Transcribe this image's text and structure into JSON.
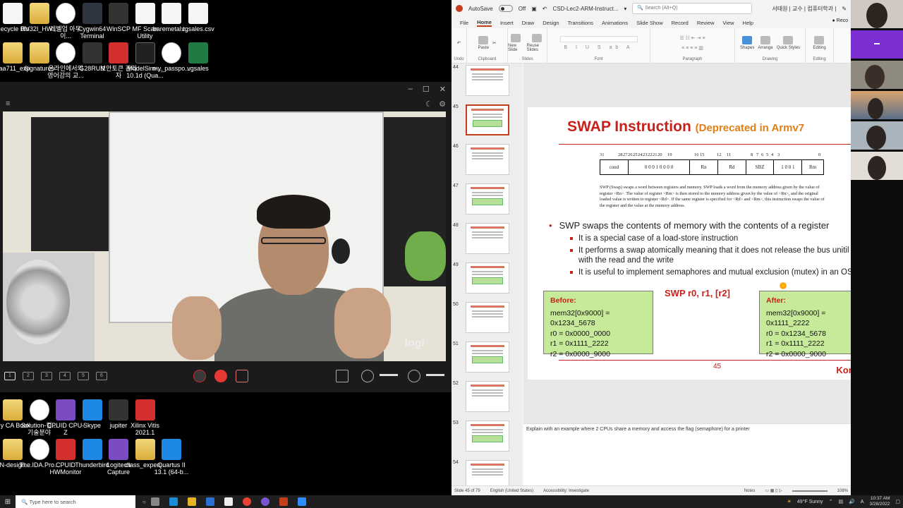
{
  "desktop": {
    "icons_top": [
      {
        "label": "Recycle Bin",
        "icon": "recycle-bin-icon"
      },
      {
        "label": "RV32I_HW...",
        "icon": "file-icon"
      },
      {
        "label": "레벨업 아두이...",
        "icon": "pdf-icon"
      },
      {
        "label": "Cygwin64 Terminal",
        "icon": "terminal-icon"
      },
      {
        "label": "WinSCP",
        "icon": "winscp-icon"
      },
      {
        "label": "MF Scan Utility",
        "icon": "scanner-icon"
      },
      {
        "label": "baremetal.t...",
        "icon": "document-icon"
      },
      {
        "label": "vgsales.csv",
        "icon": "document-icon"
      }
    ],
    "icons_row2": [
      {
        "label": "aaa711_exp",
        "icon": "folder-icon"
      },
      {
        "label": "Signatures",
        "icon": "folder-icon"
      },
      {
        "label": "온라인에서의 영어강의 교...",
        "icon": "pdf-icon"
      },
      {
        "label": "G28RUN",
        "icon": "app-icon"
      },
      {
        "label": "보안토큰 관리자",
        "icon": "security-icon"
      },
      {
        "label": "ModelSim-... 10.1d (Qua...",
        "icon": "modelsim-icon"
      },
      {
        "label": "my_passpo...",
        "icon": "pdf-icon"
      },
      {
        "label": "vgsales",
        "icon": "excel-icon"
      }
    ],
    "icons_bottom1": [
      {
        "label": "My CA Book",
        "icon": "folder-icon"
      },
      {
        "label": "Solution-컴... 기술분야",
        "icon": "pdf-icon"
      },
      {
        "label": "CPUID CPU-Z",
        "icon": "cpuz-icon"
      },
      {
        "label": "Skype",
        "icon": "skype-icon"
      },
      {
        "label": "jupiter",
        "icon": "app-icon"
      },
      {
        "label": "Xilinx Vitis 2021.1",
        "icon": "xilinx-icon"
      }
    ],
    "icons_bottom2": [
      {
        "label": "NN-design...",
        "icon": "folder-icon"
      },
      {
        "label": "The.IDA.Pro...",
        "icon": "pdf-icon"
      },
      {
        "label": "CPUID HWMonitor",
        "icon": "hwmonitor-icon"
      },
      {
        "label": "Thunderbird",
        "icon": "thunderbird-icon"
      },
      {
        "label": "Logitech Capture",
        "icon": "logitech-icon"
      },
      {
        "label": "class_experi...",
        "icon": "folder-icon"
      },
      {
        "label": "Quartus II 13.1 (64-b...",
        "icon": "quartus-icon"
      }
    ]
  },
  "logi": {
    "watermark": "logi",
    "layouts": [
      "1",
      "2",
      "3",
      "4",
      "5",
      "6"
    ]
  },
  "ppt": {
    "autosave": "AutoSave",
    "autosave_state": "Off",
    "filename": "CSD-Lec2-ARM-Instruct...",
    "search_placeholder": "Search (Alt+Q)",
    "user": "서태원 | 교수 | 컴퓨터학과 |",
    "record_btn": "Reco",
    "tabs": [
      "File",
      "Home",
      "Insert",
      "Draw",
      "Design",
      "Transitions",
      "Animations",
      "Slide Show",
      "Record",
      "Review",
      "View",
      "Help"
    ],
    "ribbon_groups": [
      "Undo",
      "Clipboard",
      "Slides",
      "Font",
      "Paragraph",
      "Drawing",
      "Editing"
    ],
    "ribbon_buttons": {
      "paste": "Paste",
      "new_slide": "New Slide",
      "reuse_slides": "Reuse Slides",
      "shapes": "Shapes",
      "arrange": "Arrange",
      "quick_styles": "Quick Styles",
      "editing": "Editing"
    },
    "thumbs": [
      {
        "num": "44",
        "title": "SWAP Instruction"
      },
      {
        "num": "45",
        "title": "SWAP Instruction"
      },
      {
        "num": "46",
        "title": "Semaphore Example"
      },
      {
        "num": "47",
        "title": "LDREX, STREX Instructions"
      },
      {
        "num": "48",
        "title": "Example"
      },
      {
        "num": "49",
        "title": "CLREX Instructions"
      },
      {
        "num": "50",
        "title": "Miscellaneous but Important Instructions"
      },
      {
        "num": "51",
        "title": "SVC (previously SWI: Software Interrupt)"
      },
      {
        "num": "52",
        "title": "Example"
      },
      {
        "num": "53",
        "title": "Program Status Register Instructions"
      },
      {
        "num": "54",
        "title": "Job is Done"
      }
    ],
    "slide": {
      "title": "SWAP Instruction",
      "title_sub": "(Deprecated in Armv7",
      "bit_labels": [
        "31",
        "28",
        "27",
        "26",
        "25",
        "24",
        "23",
        "22",
        "21",
        "20",
        "19",
        "16",
        "15",
        "12",
        "11",
        "8",
        "7",
        "6",
        "5",
        "4",
        "3",
        "0"
      ],
      "encoding_fields": [
        "cond",
        "0 0 0 1 0 0 0 0",
        "Rn",
        "Rd",
        "SBZ",
        "1 0 0 1",
        "Rm"
      ],
      "description": "SWP (Swap) swaps a word between registers and memory. SWP loads a word from the memory address given by the value of register <Rn>. The value of register <Rm> is then stored to the memory address given by the value of <Rn>, and the original loaded value is written to register <Rd>. If the same register is specified for <Rd> and <Rm>, this instruction swaps the value of the register and the value at the memory address.",
      "bullet_main": "SWP swaps the contents of memory with the contents of a register",
      "bullets_sub": [
        "It is a special case of a load-store instruction",
        "It performs a swap atomically meaning that it does not release the bus unitil it is done with the read and the write",
        "It is useful to implement semaphores and mutual exclusion (mutex) in an OS"
      ],
      "code": "SWP r0, r1, [r2]",
      "before": {
        "heading": "Before:",
        "lines": [
          "mem32[0x9000] = 0x1234_5678",
          "r0 = 0x0000_0000",
          "r1 = 0x1111_2222",
          "r2 = 0x0000_9000"
        ]
      },
      "after": {
        "heading": "After:",
        "lines": [
          "mem32[0x9000] = 0x1111_2222",
          "r0 = 0x1234_5678",
          "r1 = 0x1111_2222",
          "r2 = 0x0000_9000"
        ]
      },
      "page_number": "45",
      "footer": "Korea Univ"
    },
    "notes": "Explain with an example where 2 CPUs share a memory and access the flag (semaphore) for a printer",
    "status": {
      "slide_info": "Slide 45 of 79",
      "language": "English (United States)",
      "accessibility": "Accessibility: Investigate",
      "notes_btn": "Notes",
      "zoom": "108%"
    }
  },
  "taskbar": {
    "search_placeholder": "Type here to search",
    "weather": "49°F Sunny",
    "lang": "A",
    "time": "10:37 AM",
    "date": "3/28/2022"
  }
}
